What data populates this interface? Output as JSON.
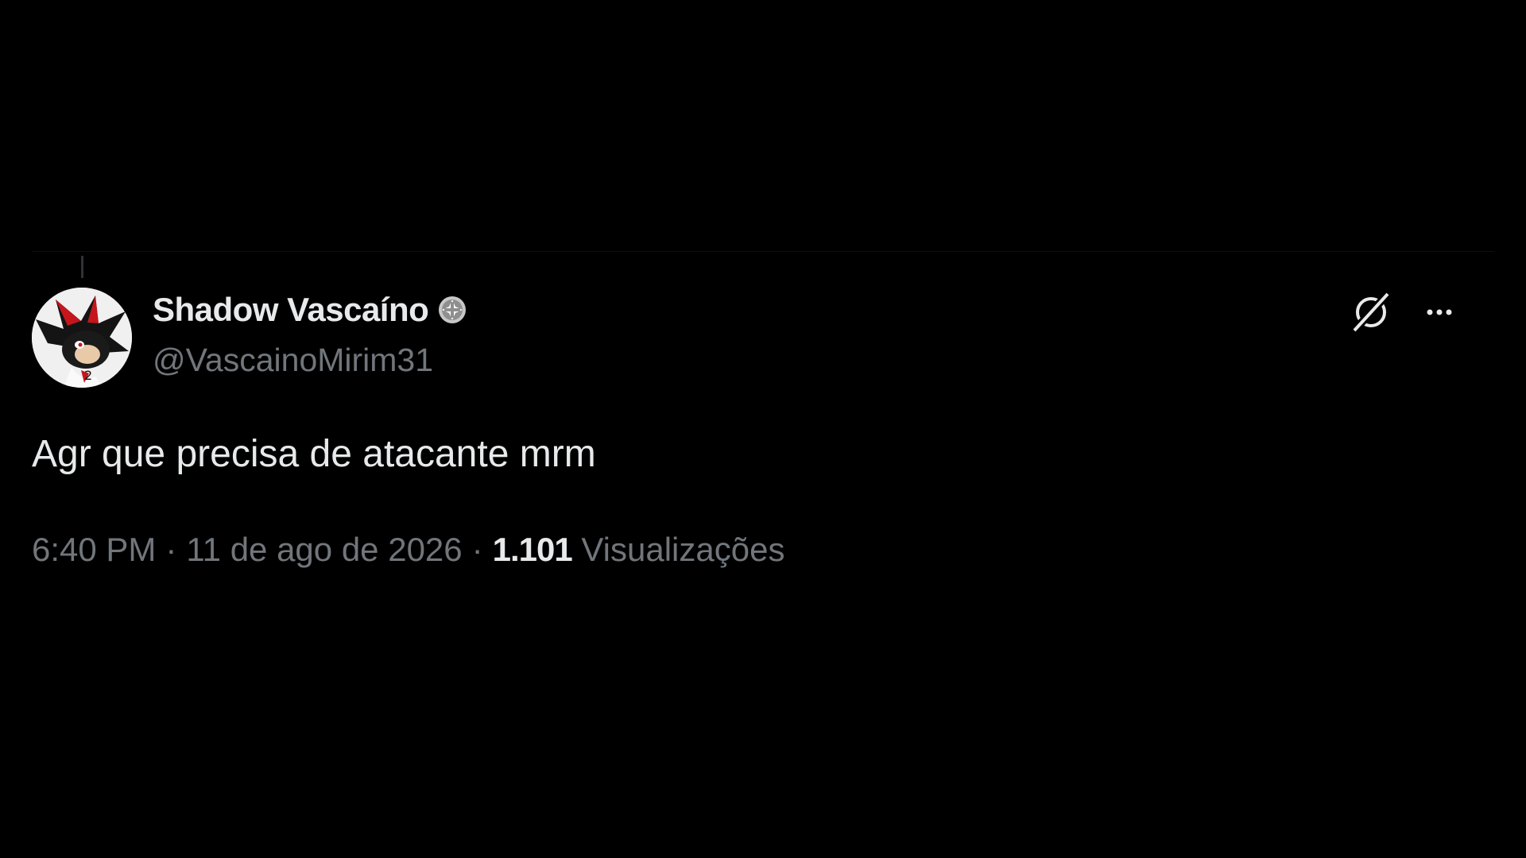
{
  "tweet": {
    "author": {
      "display_name": "Shadow Vascaíno",
      "handle": "@VascainoMirim31",
      "badge_icon": "club-crest-icon"
    },
    "text": "Agr que precisa de atacante mrm",
    "time": "6:40 PM",
    "separator": "·",
    "date": "11 de ago de 2026",
    "views_count": "1.101",
    "views_label": "Visualizações"
  },
  "actions": {
    "grok_icon": "grok-icon",
    "more_icon": "more-icon"
  },
  "colors": {
    "background": "#000000",
    "primary_text": "#e7e9ea",
    "secondary_text": "#71767b"
  }
}
